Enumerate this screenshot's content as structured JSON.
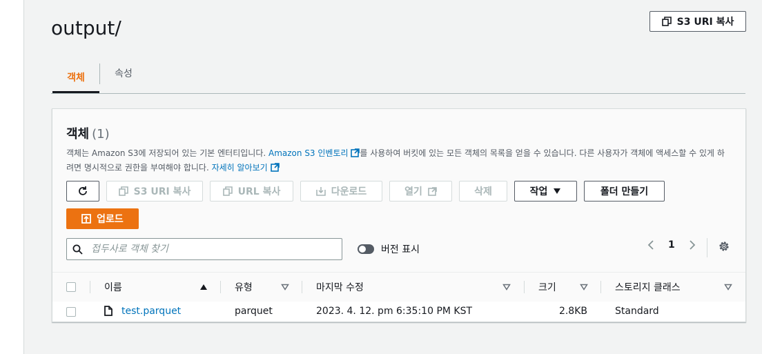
{
  "page": {
    "title": "output/",
    "copy_s3_uri_label": "S3 URI 복사"
  },
  "tabs": [
    {
      "label": "객체",
      "active": true
    },
    {
      "label": "속성",
      "active": false
    }
  ],
  "objects_panel": {
    "title": "객체",
    "count": "(1)",
    "description_part1": "객체는 Amazon S3에 저장되어 있는 기본 엔터티입니다. ",
    "inventory_link": "Amazon S3 인벤토리",
    "description_part2": "를 사용하여 버킷에 있는 모든 객체의 목록을 얻을 수 있습니다. 다른 사용자가 객체에 액세스할 수 있게 하려면 명시적으로 권한을 부여해야 합니다. ",
    "learn_more_link": "자세히 알아보기"
  },
  "toolbar": {
    "refresh_icon": "refresh-icon",
    "copy_s3_uri": "S3 URI 복사",
    "copy_url": "URL 복사",
    "download": "다운로드",
    "open": "열기",
    "delete": "삭제",
    "actions": "작업",
    "create_folder": "폴더 만들기",
    "upload": "업로드"
  },
  "search": {
    "placeholder": "접두사로 객체 찾기"
  },
  "versions_toggle": {
    "label": "버전 표시",
    "on": false
  },
  "pagination": {
    "current_page": "1"
  },
  "table": {
    "columns": [
      "이름",
      "유형",
      "마지막 수정",
      "크기",
      "스토리지 클래스"
    ],
    "rows": [
      {
        "name": "test.parquet",
        "type": "parquet",
        "last_modified": "2023. 4. 12. pm 6:35:10 PM KST",
        "size": "2.8KB",
        "storage_class": "Standard"
      }
    ]
  },
  "colors": {
    "accent_orange": "#ec7211",
    "link_blue": "#0073bb",
    "text": "#16191f",
    "disabled": "#aab7b8"
  }
}
